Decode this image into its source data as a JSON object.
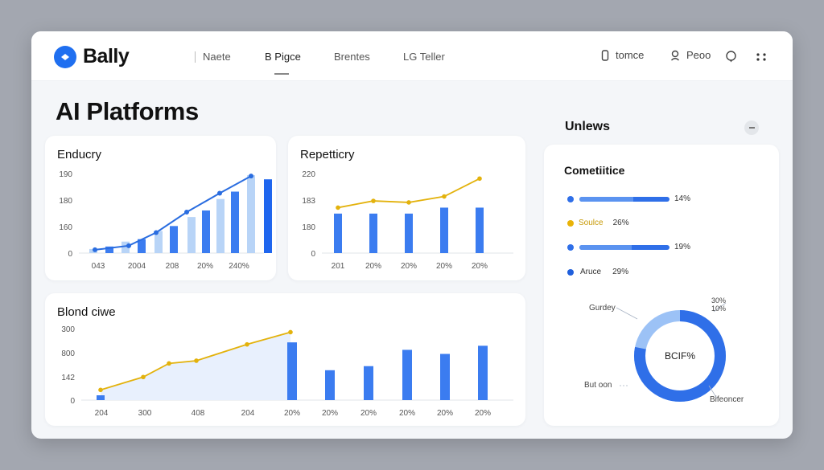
{
  "header": {
    "brand": "Bally",
    "nav": [
      "Naete",
      "B Pigce",
      "Brentes",
      "LG Teller"
    ],
    "active_nav_index": 1,
    "right_items": [
      {
        "label": "tomce",
        "icon": "phone-icon"
      },
      {
        "label": "Peoo",
        "icon": "user-icon"
      }
    ],
    "icons": [
      "help-icon",
      "grid-icon"
    ]
  },
  "page": {
    "title": "AI Platforms"
  },
  "cards": {
    "industry": {
      "title": "Enducry",
      "y_ticks": [
        "190",
        "180",
        "160",
        "0"
      ],
      "x_ticks": [
        "043",
        "2004",
        "208",
        "20%",
        "240%"
      ]
    },
    "repetition": {
      "title": "Repetticry",
      "y_ticks": [
        "220",
        "183",
        "180",
        "0"
      ],
      "x_ticks": [
        "201",
        "20%",
        "20%",
        "20%",
        "20%"
      ]
    },
    "blend": {
      "title": "Blond ciwe",
      "y_ticks": [
        "300",
        "800",
        "142",
        "0"
      ],
      "x_ticks": [
        "204",
        "300",
        "408",
        "204",
        "20%",
        "20%",
        "20%",
        "20%",
        "20%",
        "20%"
      ]
    }
  },
  "chart_data": [
    {
      "type": "bar",
      "title": "Enducry",
      "categories": [
        "043",
        "2004",
        "208",
        "20%",
        "240%"
      ],
      "series": [
        {
          "values": [
            5,
            14,
            27,
            44,
            66,
            95
          ]
        },
        {
          "values": [
            8,
            17,
            33,
            52,
            75,
            90
          ]
        }
      ],
      "line": [
        4,
        9,
        25,
        50,
        73,
        94
      ],
      "ylim": [
        0,
        100
      ]
    },
    {
      "type": "bar",
      "title": "Repetticry",
      "categories": [
        "201",
        "20%",
        "20%",
        "20%",
        "20%"
      ],
      "values": [
        53,
        53,
        53,
        61,
        61
      ],
      "line": [
        61,
        70,
        68,
        76,
        100
      ],
      "ylim": [
        0,
        110
      ]
    },
    {
      "type": "area",
      "title": "Blond ciwe",
      "categories": [
        "204",
        "300",
        "408",
        "204",
        "20%",
        "20%",
        "20%",
        "20%",
        "20%",
        "20%"
      ],
      "line": [
        15,
        34,
        54,
        58,
        82,
        100
      ],
      "bars": [
        85,
        44,
        50,
        74,
        68,
        80
      ],
      "ylim": [
        0,
        110
      ]
    }
  ],
  "side": {
    "title": "Unlews",
    "competitive": {
      "title": "Cometiitice",
      "rows": [
        {
          "label": "",
          "value": "14%",
          "color": "#2f6fe8"
        },
        {
          "label": "Soulce",
          "value": "26%",
          "color": "#e9b308"
        },
        {
          "label": "",
          "value": "19%",
          "color": "#2f6fe8"
        },
        {
          "label": "Aruce",
          "value": "29%",
          "color": "#1f5fdc"
        }
      ]
    },
    "donut": {
      "center": "BCIF%",
      "label_top_1": "30%",
      "label_top_2": "10%",
      "label_left": "Gurdey",
      "label_bottom_left": "But oon",
      "label_bottom_right": "Bifeoncer",
      "value": 0.78,
      "colors": {
        "main": "#2f6fe8",
        "light": "#9cc2f6"
      }
    }
  }
}
